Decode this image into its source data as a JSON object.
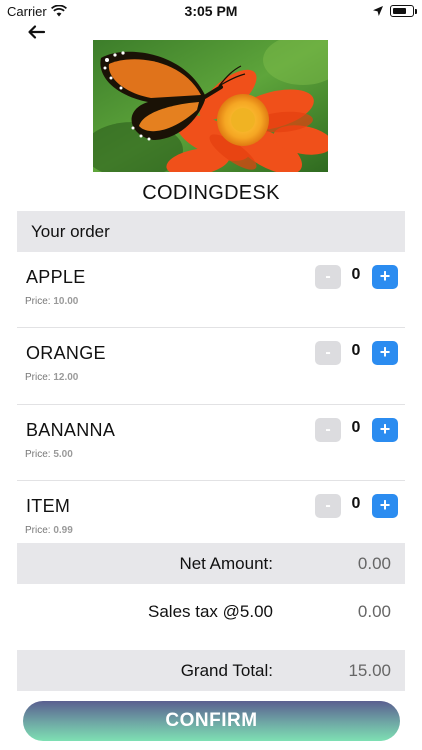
{
  "status_bar": {
    "carrier": "Carrier",
    "time": "3:05 PM",
    "battery_level": 0.75,
    "icons": [
      "wifi-icon",
      "location-icon",
      "battery-icon"
    ]
  },
  "header": {
    "back_icon": "back-arrow-icon",
    "shop_name": "CODINGDESK"
  },
  "order": {
    "title": "Your order",
    "price_prefix": "Price:",
    "minus_label": "-",
    "plus_label": "+",
    "items": [
      {
        "name": "APPLE",
        "price": "10.00",
        "quantity": "0"
      },
      {
        "name": "ORANGE",
        "price": "12.00",
        "quantity": "0"
      },
      {
        "name": "BANANNA",
        "price": "5.00",
        "quantity": "0"
      },
      {
        "name": "ITEM",
        "price": "0.99",
        "quantity": "0"
      }
    ]
  },
  "totals": {
    "net_label": "Net Amount:",
    "net_value": "0.00",
    "tax_label": "Sales tax @5.00",
    "tax_value": "0.00",
    "grand_label": "Grand Total:",
    "grand_value": "15.00"
  },
  "confirm_label": "CONFIRM",
  "colors": {
    "accent": "#2b8cf0",
    "row_background": "#e7e7ea",
    "minus_button": "#dcdcdf",
    "confirm_gradient_top": "#5a5f8f",
    "confirm_gradient_bottom": "#7ee0b3"
  }
}
